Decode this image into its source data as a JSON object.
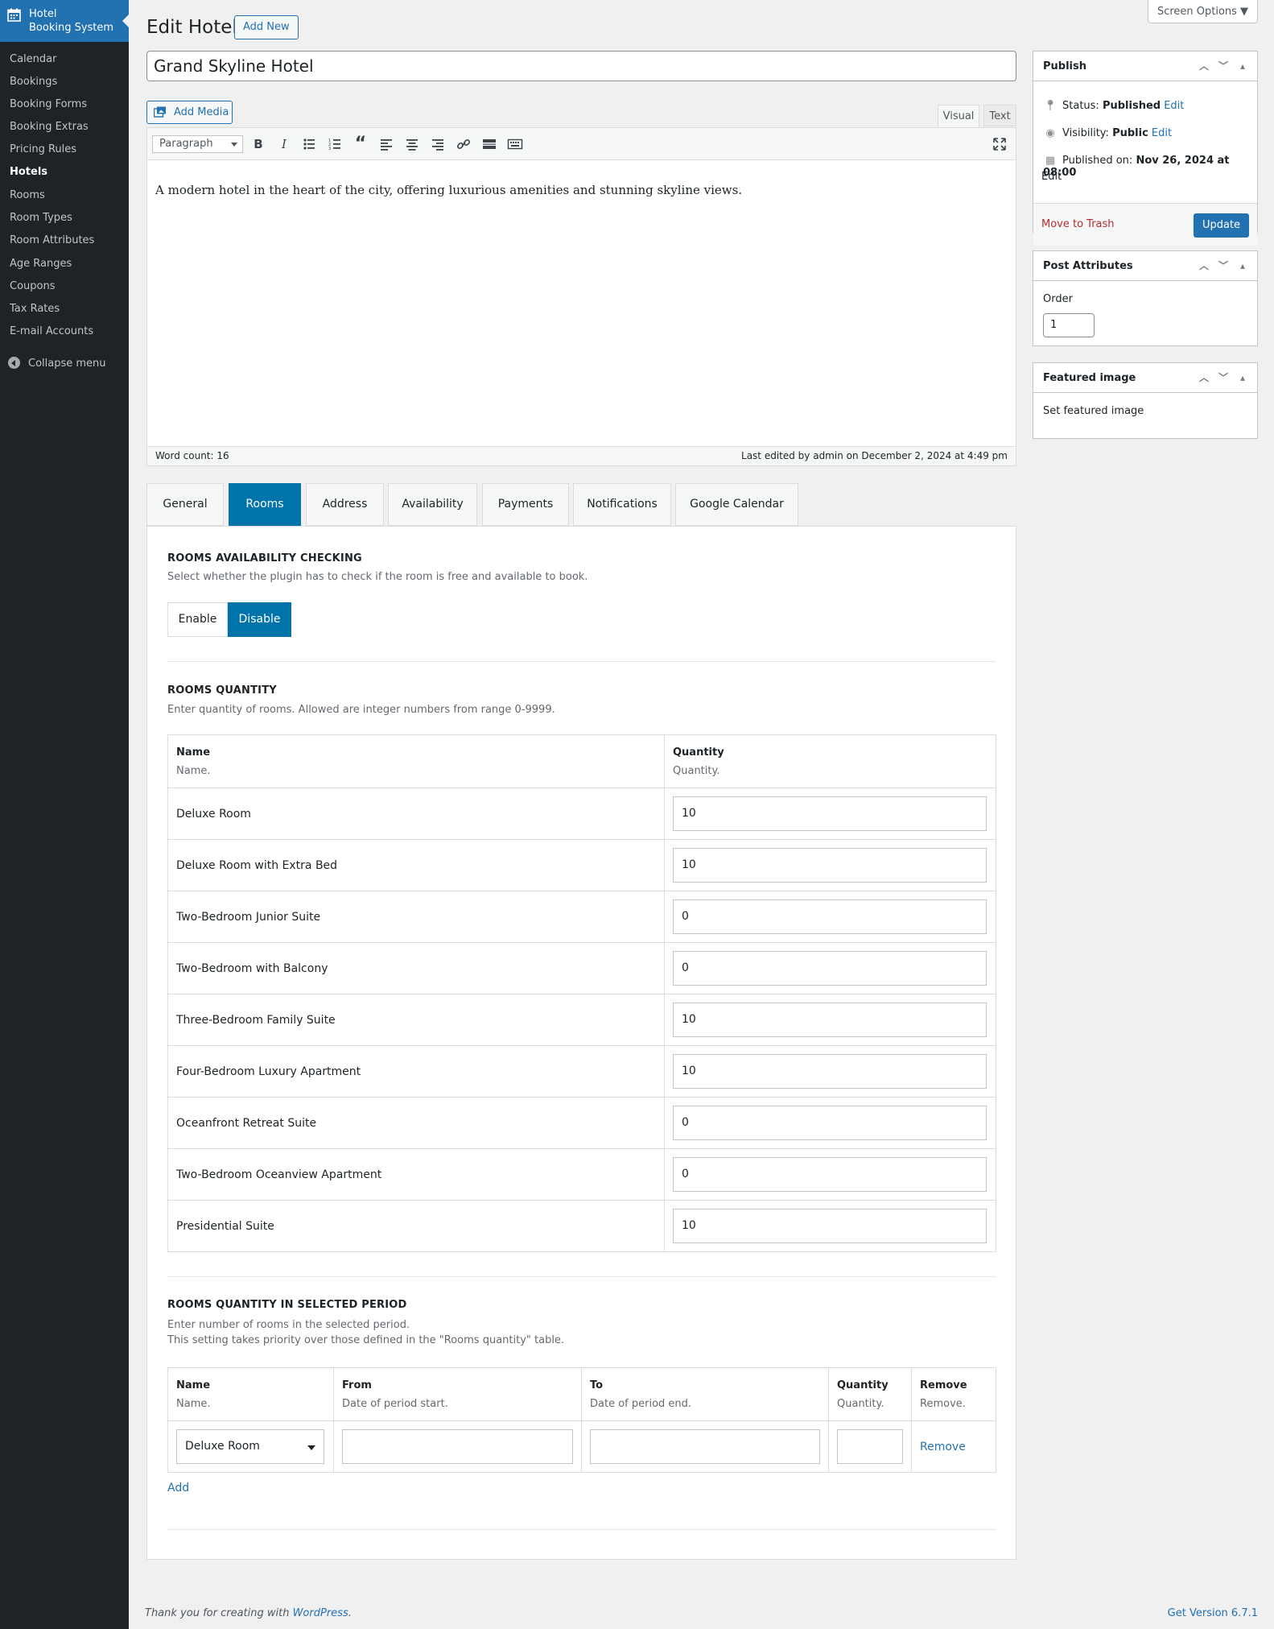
{
  "sidebar": {
    "brand_line1": "Hotel",
    "brand_line2": "Booking System",
    "items": [
      {
        "label": "Calendar"
      },
      {
        "label": "Bookings"
      },
      {
        "label": "Booking Forms"
      },
      {
        "label": "Booking Extras"
      },
      {
        "label": "Pricing Rules"
      },
      {
        "label": "Hotels"
      },
      {
        "label": "Rooms"
      },
      {
        "label": "Room Types"
      },
      {
        "label": "Room Attributes"
      },
      {
        "label": "Age Ranges"
      },
      {
        "label": "Coupons"
      },
      {
        "label": "Tax Rates"
      },
      {
        "label": "E-mail Accounts"
      }
    ],
    "collapse_label": "Collapse menu"
  },
  "header": {
    "title": "Edit Hotel",
    "add_new": "Add New",
    "screen_options": "Screen Options ▼"
  },
  "post": {
    "title": "Grand Skyline Hotel",
    "content": "A modern hotel in the heart of the city, offering luxurious amenities and stunning skyline views."
  },
  "editor": {
    "add_media": "Add Media",
    "tab_visual": "Visual",
    "tab_text": "Text",
    "format": "Paragraph",
    "word_count": "Word count: 16",
    "last_edited": "Last edited by admin on December 2, 2024 at 4:49 pm"
  },
  "tabs": [
    {
      "label": "General"
    },
    {
      "label": "Rooms"
    },
    {
      "label": "Address"
    },
    {
      "label": "Availability"
    },
    {
      "label": "Payments"
    },
    {
      "label": "Notifications"
    },
    {
      "label": "Google Calendar"
    }
  ],
  "active_tab": "Rooms",
  "availability": {
    "title": "ROOMS AVAILABILITY CHECKING",
    "desc": "Select whether the plugin has to check if the room is free and available to book.",
    "enable": "Enable",
    "disable": "Disable",
    "selected": "Disable"
  },
  "quantity": {
    "title": "ROOMS QUANTITY",
    "desc": "Enter quantity of rooms. Allowed are integer numbers from range 0-9999.",
    "col_name": "Name",
    "col_name_sub": "Name.",
    "col_qty": "Quantity",
    "col_qty_sub": "Quantity.",
    "rows": [
      {
        "name": "Deluxe Room",
        "qty": "10"
      },
      {
        "name": "Deluxe Room with Extra Bed",
        "qty": "10"
      },
      {
        "name": "Two-Bedroom Junior Suite",
        "qty": "0"
      },
      {
        "name": "Two-Bedroom with Balcony",
        "qty": "0"
      },
      {
        "name": "Three-Bedroom Family Suite",
        "qty": "10"
      },
      {
        "name": "Four-Bedroom Luxury Apartment",
        "qty": "10"
      },
      {
        "name": "Oceanfront Retreat Suite",
        "qty": "0"
      },
      {
        "name": "Two-Bedroom Oceanview Apartment",
        "qty": "0"
      },
      {
        "name": "Presidential Suite",
        "qty": "10"
      }
    ]
  },
  "period": {
    "title": "ROOMS QUANTITY IN SELECTED PERIOD",
    "desc1": "Enter number of rooms in the selected period.",
    "desc2": "This setting takes priority over those defined in the \"Rooms quantity\" table.",
    "cols": [
      {
        "h": "Name",
        "s": "Name."
      },
      {
        "h": "From",
        "s": "Date of period start."
      },
      {
        "h": "To",
        "s": "Date of period end."
      },
      {
        "h": "Quantity",
        "s": "Quantity."
      },
      {
        "h": "Remove",
        "s": "Remove."
      }
    ],
    "row": {
      "name": "Deluxe Room",
      "from": "",
      "to": "",
      "qty": "",
      "remove": "Remove"
    },
    "add": "Add"
  },
  "publish": {
    "title": "Publish",
    "status_label": "Status:",
    "status_value": "Published",
    "visibility_label": "Visibility:",
    "visibility_value": "Public",
    "published_label": "Published on:",
    "published_value": "Nov 26, 2024 at 08:00",
    "edit": "Edit",
    "trash": "Move to Trash",
    "update": "Update"
  },
  "attributes": {
    "title": "Post Attributes",
    "order_label": "Order",
    "order_value": "1"
  },
  "featured": {
    "title": "Featured image",
    "link": "Set featured image"
  },
  "footer": {
    "thanks_prefix": "Thank you for creating with ",
    "wp": "WordPress",
    "thanks_suffix": ".",
    "version": "Get Version 6.7.1"
  }
}
